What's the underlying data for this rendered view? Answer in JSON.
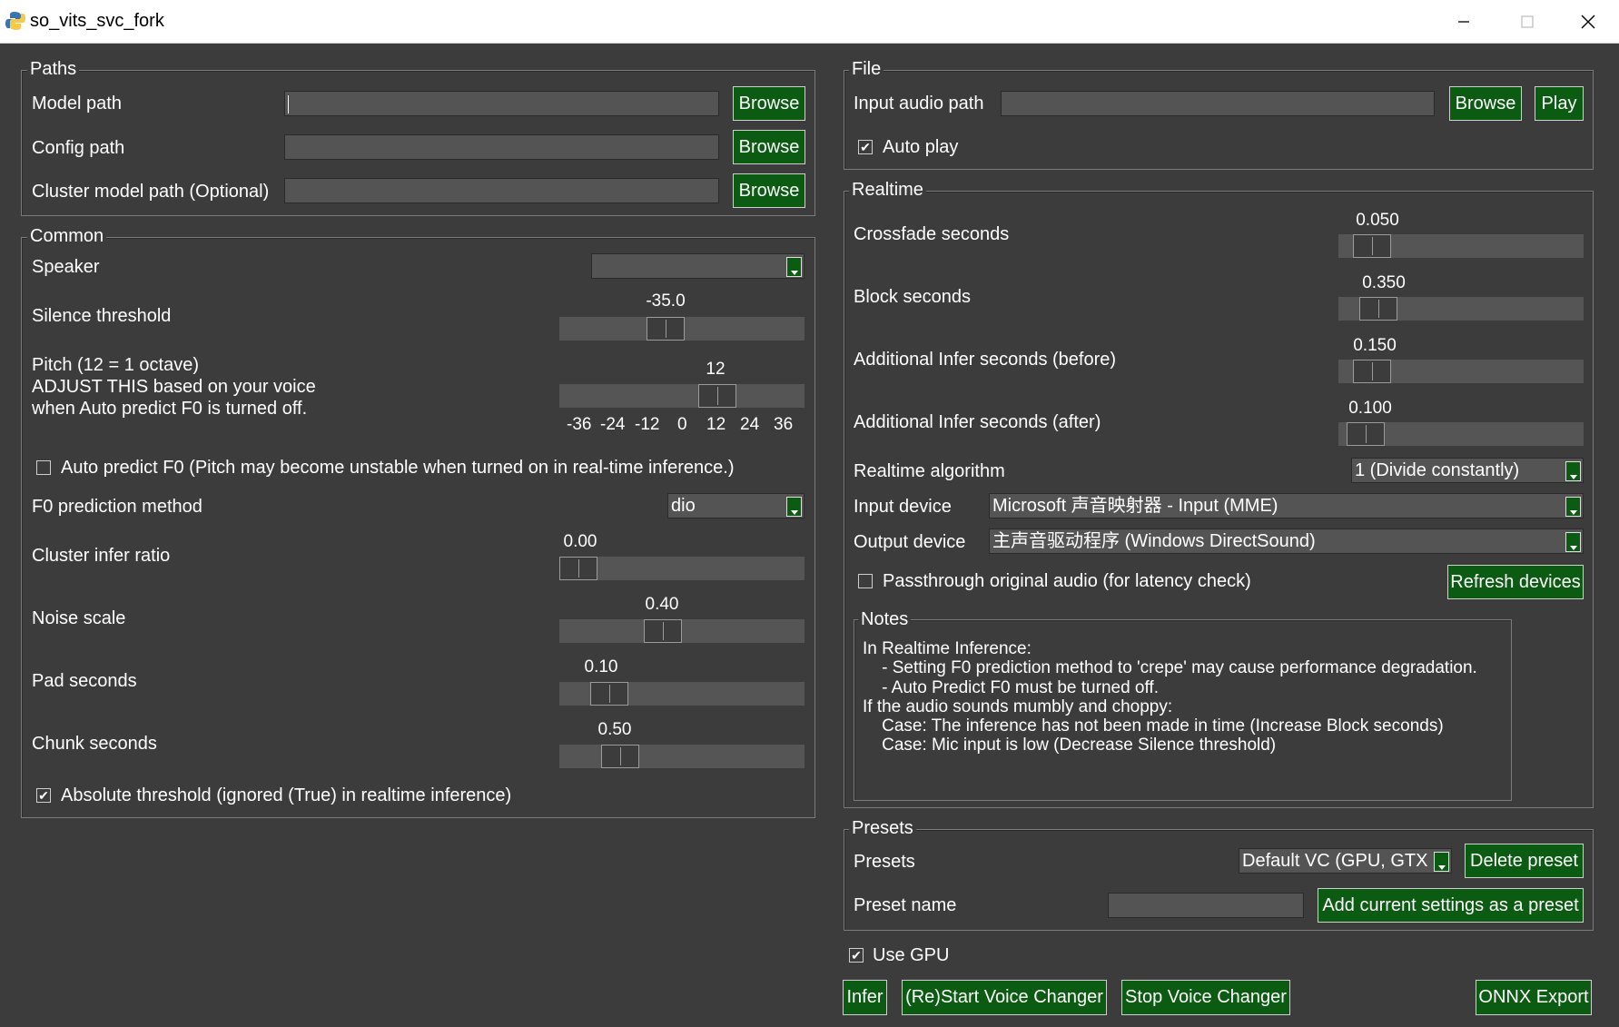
{
  "window": {
    "title": "so_vits_svc_fork",
    "minimize_icon": "minimize-icon",
    "maximize_icon": "maximize-icon",
    "close_icon": "close-icon"
  },
  "paths": {
    "title": "Paths",
    "model_path_label": "Model path",
    "config_path_label": "Config path",
    "cluster_path_label": "Cluster model path (Optional)",
    "browse_label": "Browse"
  },
  "common": {
    "title": "Common",
    "speaker_label": "Speaker",
    "speaker_value": "",
    "silence_label": "Silence threshold",
    "silence_value": "-35.0",
    "pitch_label_1": "Pitch (12 = 1 octave)",
    "pitch_label_2": "ADJUST THIS based on your voice",
    "pitch_label_3": "when Auto predict F0 is turned off.",
    "pitch_value": "12",
    "pitch_ticks": [
      "-36",
      "-24",
      "-12",
      "0",
      "12",
      "24",
      "36"
    ],
    "auto_predict_label": "Auto predict F0 (Pitch may become unstable when turned on in real-time inference.)",
    "auto_predict_checked": false,
    "f0_method_label": "F0 prediction method",
    "f0_method_value": "dio",
    "cluster_ratio_label": "Cluster infer ratio",
    "cluster_ratio_value": "0.00",
    "noise_scale_label": "Noise scale",
    "noise_scale_value": "0.40",
    "pad_seconds_label": "Pad seconds",
    "pad_seconds_value": "0.10",
    "chunk_seconds_label": "Chunk seconds",
    "chunk_seconds_value": "0.50",
    "absolute_threshold_label": "Absolute threshold (ignored (True) in realtime inference)",
    "absolute_threshold_checked": true
  },
  "file": {
    "title": "File",
    "input_audio_label": "Input audio path",
    "browse_label": "Browse",
    "play_label": "Play",
    "auto_play_label": "Auto play",
    "auto_play_checked": true
  },
  "realtime": {
    "title": "Realtime",
    "crossfade_label": "Crossfade seconds",
    "crossfade_value": "0.050",
    "block_label": "Block seconds",
    "block_value": "0.350",
    "infer_before_label": "Additional Infer seconds (before)",
    "infer_before_value": "0.150",
    "infer_after_label": "Additional Infer seconds (after)",
    "infer_after_value": "0.100",
    "algorithm_label": "Realtime algorithm",
    "algorithm_value": "1 (Divide constantly)",
    "input_device_label": "Input device",
    "input_device_value": "Microsoft 声音映射器 - Input (MME)",
    "output_device_label": "Output device",
    "output_device_value": "主声音驱动程序 (Windows DirectSound)",
    "passthrough_label": "Passthrough original audio (for latency check)",
    "passthrough_checked": false,
    "refresh_label": "Refresh devices"
  },
  "notes": {
    "title": "Notes",
    "lines": [
      "In Realtime Inference:",
      "    - Setting F0 prediction method to 'crepe' may cause performance degradation.",
      "    - Auto Predict F0 must be turned off.",
      "If the audio sounds mumbly and choppy:",
      "    Case: The inference has not been made in time (Increase Block seconds)",
      "    Case: Mic input is low (Decrease Silence threshold)"
    ]
  },
  "presets": {
    "title": "Presets",
    "presets_label": "Presets",
    "preset_value": "Default VC (GPU, GTX 1",
    "delete_label": "Delete preset",
    "preset_name_label": "Preset name",
    "add_label": "Add current settings as a preset"
  },
  "bottom": {
    "use_gpu_label": "Use GPU",
    "use_gpu_checked": true,
    "infer_label": "Infer",
    "restart_label": "(Re)Start Voice Changer",
    "stop_label": "Stop Voice Changer",
    "onnx_label": "ONNX Export"
  },
  "sliders": {
    "silence_pos": 0.42,
    "pitch_pos": 0.67,
    "cluster_ratio_pos": 0.0,
    "noise_scale_pos": 0.41,
    "pad_seconds_pos": 0.15,
    "chunk_seconds_pos": 0.2,
    "crossfade_pos": 0.07,
    "block_pos": 0.1,
    "infer_before_pos": 0.07,
    "infer_after_pos": 0.04
  },
  "colors": {
    "background": "#3c3c3c",
    "button": "#0b5b12",
    "field": "#545454",
    "trough": "#555555"
  }
}
